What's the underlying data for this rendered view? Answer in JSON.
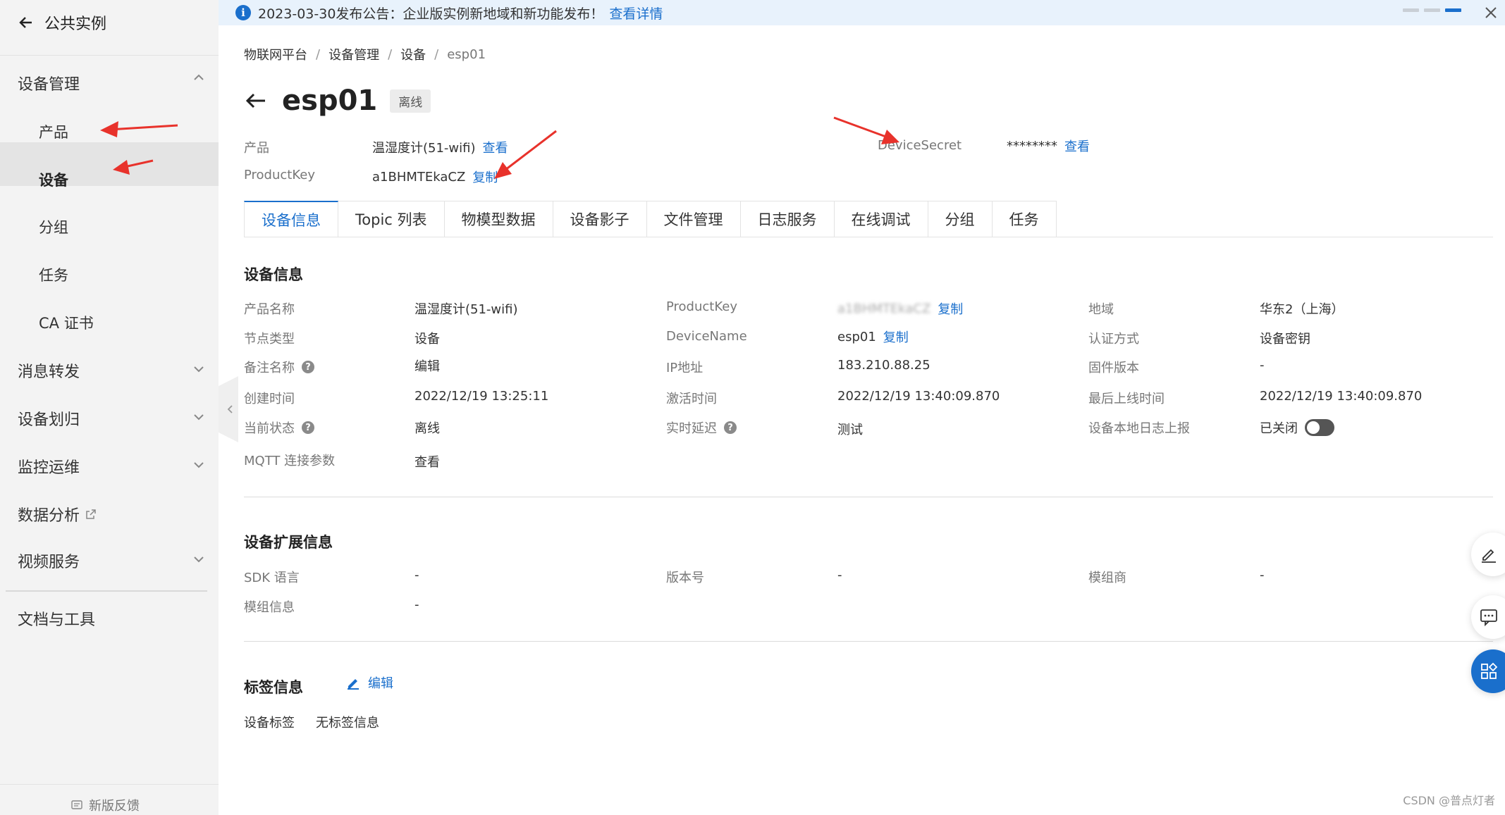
{
  "sidebar": {
    "back_label": "公共实例",
    "groups": {
      "device_mgmt": "设备管理",
      "message_forward": "消息转发",
      "device_assign": "设备划归",
      "monitor_ops": "监控运维",
      "data_analysis": "数据分析",
      "video_service": "视频服务",
      "docs_tools": "文档与工具"
    },
    "items": [
      "产品",
      "设备",
      "分组",
      "任务",
      "CA 证书"
    ],
    "feedback": "新版反馈"
  },
  "notice": {
    "text": "2023-03-30发布公告：企业版实例新地域和新功能发布！",
    "link": "查看详情"
  },
  "breadcrumb": [
    "物联网平台",
    "设备管理",
    "设备",
    "esp01"
  ],
  "device": {
    "name": "esp01",
    "status_badge": "离线",
    "product_label": "产品",
    "product_value": "温湿度计(51-wifi)",
    "product_view": "查看",
    "productkey_label": "ProductKey",
    "productkey_value": "a1BHMTEkaCZ",
    "productkey_copy": "复制",
    "secret_label": "DeviceSecret",
    "secret_value": "********",
    "secret_view": "查看"
  },
  "tabs": [
    "设备信息",
    "Topic 列表",
    "物模型数据",
    "设备影子",
    "文件管理",
    "日志服务",
    "在线调试",
    "分组",
    "任务"
  ],
  "device_info": {
    "title": "设备信息",
    "rows": [
      [
        "产品名称",
        "温湿度计(51-wifi)",
        "ProductKey",
        "a1BHMTEkaCZ",
        "地域",
        "华东2（上海）"
      ],
      [
        "节点类型",
        "设备",
        "DeviceName",
        "esp01",
        "认证方式",
        "设备密钥"
      ],
      [
        "备注名称",
        "编辑",
        "IP地址",
        "183.210.88.25",
        "固件版本",
        "-"
      ],
      [
        "创建时间",
        "2022/12/19 13:25:11",
        "激活时间",
        "2022/12/19 13:40:09.870",
        "最后上线时间",
        "2022/12/19 13:40:09.870"
      ],
      [
        "当前状态",
        "离线",
        "实时延迟",
        "测试",
        "设备本地日志上报",
        "已关闭"
      ],
      [
        "MQTT 连接参数",
        "查看"
      ]
    ],
    "copy_label": "复制"
  },
  "ext_info": {
    "title": "设备扩展信息",
    "sdk_label": "SDK 语言",
    "sdk_value": "-",
    "version_label": "版本号",
    "version_value": "-",
    "vendor_label": "模组商",
    "vendor_value": "-",
    "module_label": "模组信息",
    "module_value": "-"
  },
  "tag_info": {
    "title": "标签信息",
    "edit": "编辑",
    "tag_label": "设备标签",
    "tag_value": "无标签信息"
  },
  "watermark": "CSDN @普点灯者",
  "colors": {
    "accent": "#1a6fcc",
    "annotation_arrow": "#e8322b"
  }
}
